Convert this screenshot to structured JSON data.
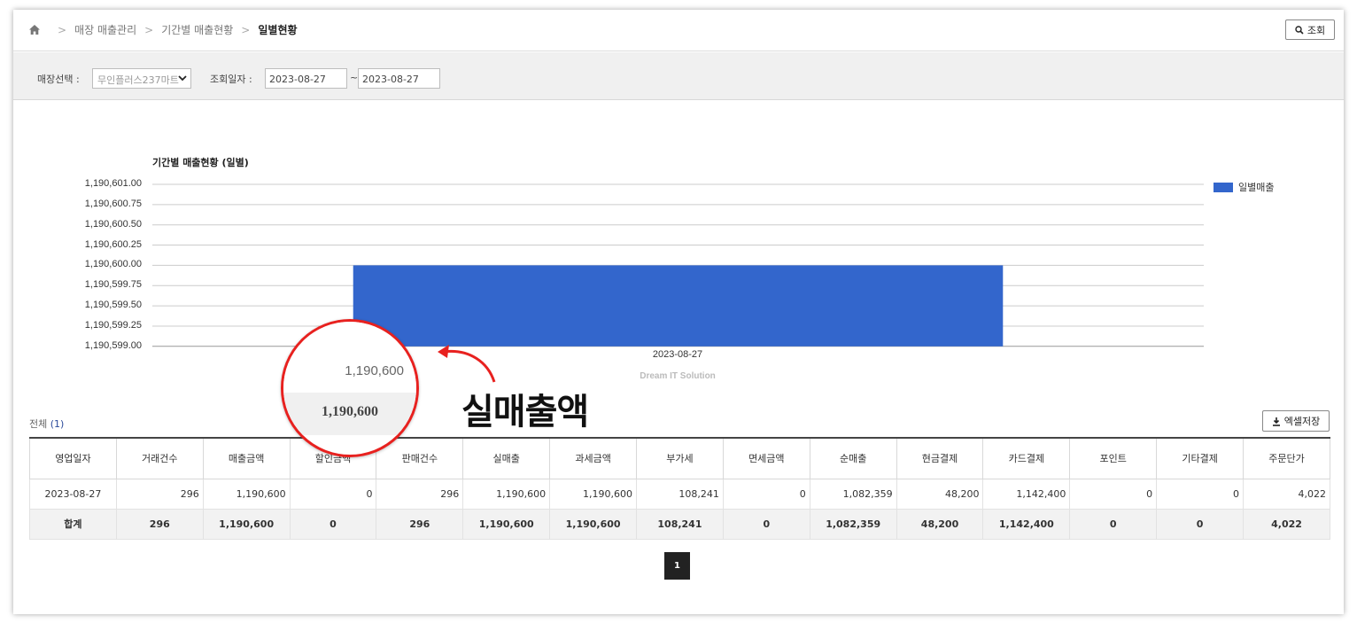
{
  "breadcrumb": {
    "items": [
      "매장 매출관리",
      "기간별 매출현황",
      "일별현황"
    ]
  },
  "header": {
    "search_label": "조회"
  },
  "filter": {
    "store_label": "매장선택 :",
    "store_value": "무인플러스237마트",
    "date_label": "조회일자 :",
    "date_from": "2023-08-27",
    "date_sep": "~",
    "date_to": "2023-08-27"
  },
  "chart_data": {
    "type": "bar",
    "title": "기간별 매출현황 (일별)",
    "categories": [
      "2023-08-27"
    ],
    "series": [
      {
        "name": "일별매출",
        "values": [
          1190600
        ],
        "color": "#3366cc"
      }
    ],
    "yticks": [
      "1,190,601.00",
      "1,190,600.75",
      "1,190,600.50",
      "1,190,600.25",
      "1,190,600.00",
      "1,190,599.75",
      "1,190,599.50",
      "1,190,599.25",
      "1,190,599.00"
    ],
    "ylim": [
      1190599,
      1190601
    ],
    "grid": true,
    "legend": "right",
    "credit": "Dream IT Solution"
  },
  "table": {
    "total_label": "전체",
    "total_count": "(1)",
    "excel_label": "엑셀저장",
    "headers": [
      "영업일자",
      "거래건수",
      "매출금액",
      "할인금액",
      "판매건수",
      "실매출",
      "과세금액",
      "부가세",
      "면세금액",
      "순매출",
      "현금결제",
      "카드결제",
      "포인트",
      "기타결제",
      "주문단가"
    ],
    "rows": [
      [
        "2023-08-27",
        "296",
        "1,190,600",
        "0",
        "296",
        "1,190,600",
        "1,190,600",
        "108,241",
        "0",
        "1,082,359",
        "48,200",
        "1,142,400",
        "0",
        "0",
        "4,022"
      ]
    ],
    "sum_row": [
      "합계",
      "296",
      "1,190,600",
      "0",
      "296",
      "1,190,600",
      "1,190,600",
      "108,241",
      "0",
      "1,082,359",
      "48,200",
      "1,142,400",
      "0",
      "0",
      "4,022"
    ]
  },
  "pager": {
    "current": "1"
  },
  "annotation": {
    "label": "실매출액",
    "zoom_top": "1,190,600",
    "zoom_bottom": "1,190,600",
    "color": "#e8211f"
  }
}
